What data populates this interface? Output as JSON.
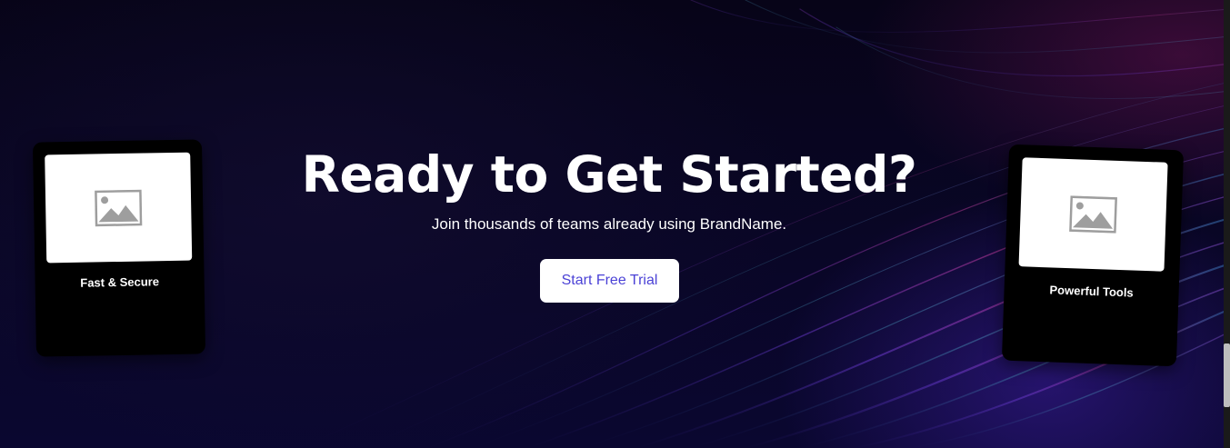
{
  "hero": {
    "title": "Ready to Get Started?",
    "subtitle": "Join thousands of teams already using BrandName.",
    "cta_label": "Start Free Trial"
  },
  "cards": [
    {
      "label": "Fast & Secure",
      "icon": "image-placeholder-icon"
    },
    {
      "label": "Powerful Tools",
      "icon": "image-placeholder-icon"
    }
  ],
  "colors": {
    "background": "#06041a",
    "cta_text": "#4b42d6",
    "card_background": "#000000"
  }
}
